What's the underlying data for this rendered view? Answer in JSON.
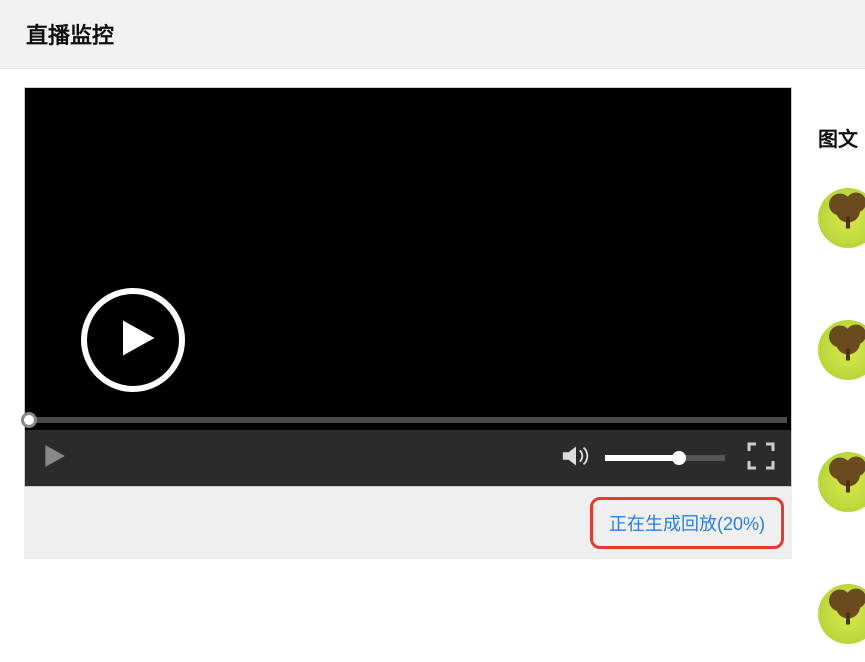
{
  "header": {
    "title": "直播监控"
  },
  "video": {
    "progress_percent": 0,
    "volume_percent": 62
  },
  "status": {
    "text": "正在生成回放(20%)"
  },
  "sidebar": {
    "title": "图文"
  }
}
